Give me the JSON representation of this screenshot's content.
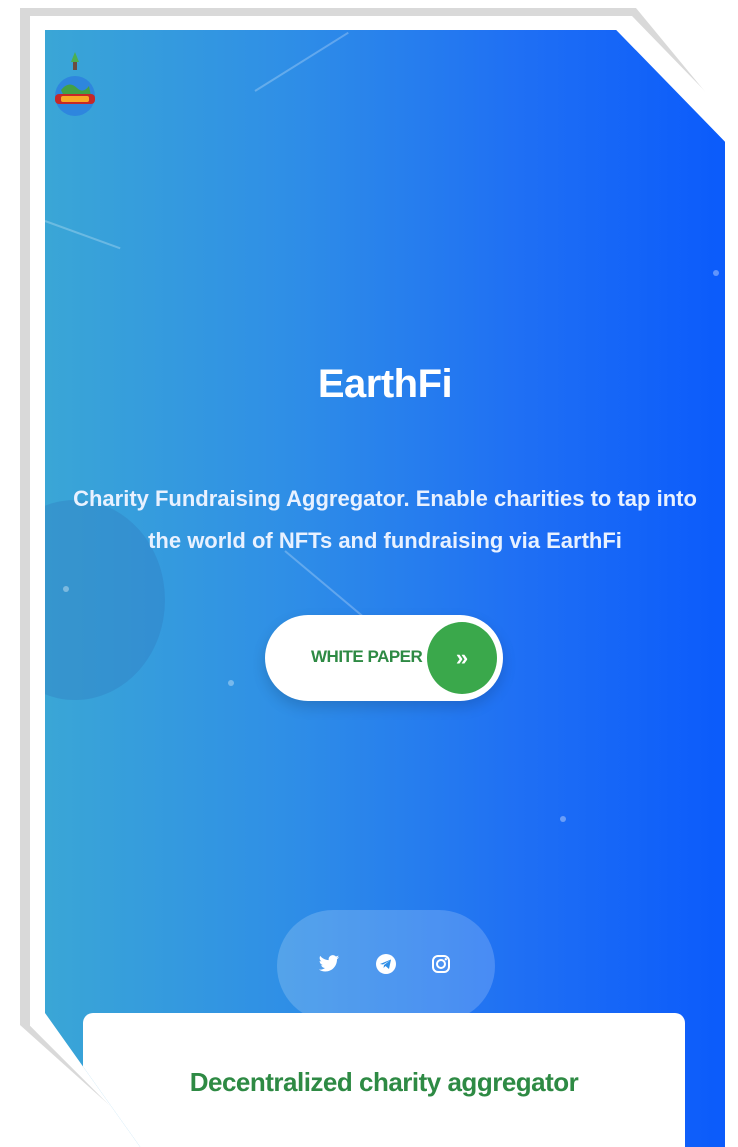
{
  "hero": {
    "title": "EarthFi",
    "subtitle": "Charity Fundraising Aggregator. Enable charities to tap into the world of NFTs and fundraising via EarthFi",
    "background_gradient": [
      "#3aa6d6",
      "#0b5bfb"
    ]
  },
  "header": {
    "logo_icon": "earth-globe-logo",
    "menu_icon": "hamburger-menu-icon"
  },
  "cta": {
    "label": "WHITE PAPER",
    "arrow_symbol": "»",
    "accent_color": "#3aa84b"
  },
  "social": {
    "icons": [
      "twitter-icon",
      "telegram-icon",
      "instagram-icon"
    ]
  },
  "card": {
    "title": "Decentralized charity aggregator",
    "accent_color": "#2e8a44"
  }
}
